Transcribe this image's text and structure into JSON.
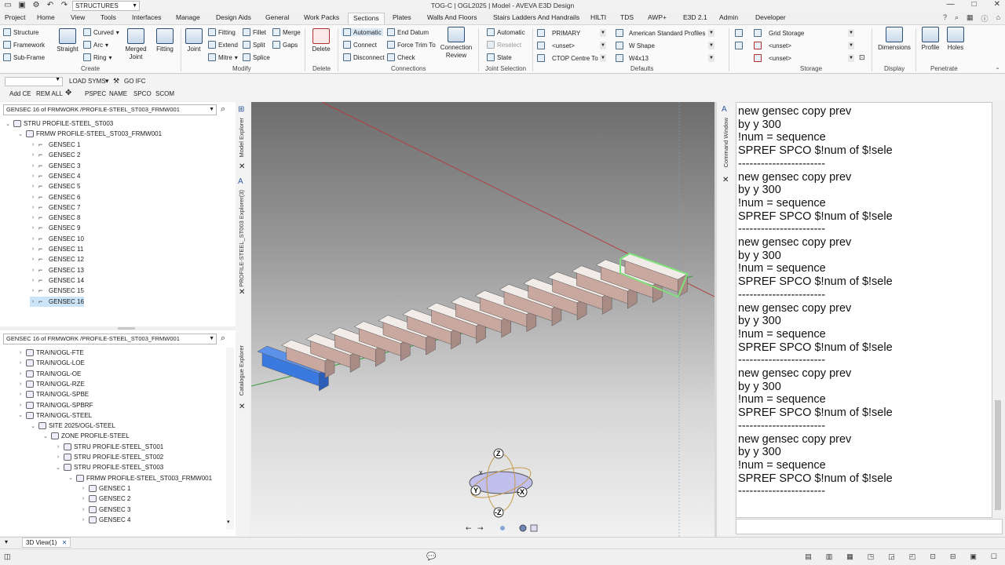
{
  "titlebar": {
    "module": "STRUCTURES",
    "title": "TOG-C | OGL2025 | Model - AVEVA E3D Design",
    "window_buttons": [
      "—",
      "□",
      "✕"
    ]
  },
  "tabs": [
    {
      "label": "Project"
    },
    {
      "label": "Home"
    },
    {
      "label": "View"
    },
    {
      "label": "Tools"
    },
    {
      "label": "Interfaces"
    },
    {
      "label": "Manage"
    },
    {
      "label": "Design Aids"
    },
    {
      "label": "General"
    },
    {
      "label": "Work Packs"
    },
    {
      "label": "Sections"
    },
    {
      "label": "Plates"
    },
    {
      "label": "Walls And Floors"
    },
    {
      "label": "Stairs Ladders And Handrails"
    },
    {
      "label": "HILTI"
    },
    {
      "label": "TDS"
    },
    {
      "label": "AWP+"
    },
    {
      "label": "E3D 2.1"
    },
    {
      "label": "Admin"
    },
    {
      "label": "Developer"
    }
  ],
  "active_tab": "Sections",
  "ribbon": {
    "create": {
      "structure": "Structure",
      "framework": "Framework",
      "subframe": "Sub-Frame",
      "straight": "Straight",
      "curved": "Curved",
      "arc": "Arc",
      "ring": "Ring",
      "merged_joint": "Merged Joint",
      "fitting": "Fitting",
      "label": "Create"
    },
    "modify": {
      "joint": "Joint",
      "fitting": "Fitting",
      "fillet": "Fillet",
      "merge": "Merge",
      "extend": "Extend",
      "split": "Split",
      "gaps": "Gaps",
      "mitre": "Mitre",
      "splice": "Splice",
      "label": "Modify"
    },
    "delete": {
      "delete": "Delete",
      "label": "Delete"
    },
    "connections": {
      "automatic": "Automatic",
      "connect": "Connect",
      "disconnect": "Disconnect",
      "end_datum": "End Datum",
      "force_trim": "Force Trim To",
      "check": "Check",
      "connection_review": "Connection Review",
      "label": "Connections"
    },
    "joint_selection": {
      "automatic": "Automatic",
      "reselect": "Reselect",
      "state": "State",
      "label": "Joint Selection"
    },
    "defaults": {
      "primary": "PRIMARY",
      "unset": "<unset>",
      "ctop": "CTOP Centre To",
      "profiles": "American Standard Profiles",
      "wshape": "W Shape",
      "w4x13": "W4x13",
      "label": "Defaults"
    },
    "storage": {
      "grid": "Grid Storage",
      "unset1": "<unset>",
      "unset2": "<unset>",
      "label": "Storage"
    },
    "display": {
      "dimensions": "Dimensions",
      "label": "Display"
    },
    "penetrate": {
      "profile": "Profile",
      "holes": "Holes",
      "label": "Penetrate"
    }
  },
  "toolbar2": {
    "load_syms": "LOAD SYMS",
    "go_ifc": "GO IFC",
    "add_ce": "Add CE",
    "rem_all": "REM ALL",
    "pspec": "PSPEC",
    "name": "NAME",
    "spco": "SPCO",
    "scom": "SCOM"
  },
  "model_explorer": {
    "tab": "Model Explorer",
    "secondary_tab": "PROFILE-STEEL_ST003 Explorer(3)",
    "header": "GENSEC 16 of FRMWORK /PROFILE-STEEL_ST003_FRMW001",
    "stru": "STRU PROFILE-STEEL_ST003",
    "frmw": "FRMW PROFILE-STEEL_ST003_FRMW001",
    "gensecs": [
      "GENSEC 1",
      "GENSEC 2",
      "GENSEC 3",
      "GENSEC 4",
      "GENSEC 5",
      "GENSEC 6",
      "GENSEC 7",
      "GENSEC 8",
      "GENSEC 9",
      "GENSEC 10",
      "GENSEC 11",
      "GENSEC 12",
      "GENSEC 13",
      "GENSEC 14",
      "GENSEC 15",
      "GENSEC 16"
    ]
  },
  "catalogue_explorer": {
    "tab": "Catalogue Explorer",
    "header": "GENSEC 16 of FRMWORK /PROFILE-STEEL_ST003_FRMW001",
    "trains": [
      "TRAIN/OGL-FTE",
      "TRAIN/OGL-LOE",
      "TRAIN/OGL-OE",
      "TRAIN/OGL-RZE",
      "TRAIN/OGL-SPBE",
      "TRAIN/OGL-SPBRF",
      "TRAIN/OGL-STEEL"
    ],
    "site": "SITE 2025/OGL-STEEL",
    "zone": "ZONE PROFILE-STEEL",
    "strus": [
      "STRU PROFILE-STEEL_ST001",
      "STRU PROFILE-STEEL_ST002",
      "STRU PROFILE-STEEL_ST003"
    ],
    "frmw": "FRMW PROFILE-STEEL_ST003_FRMW001",
    "gensecs": [
      "GENSEC 1",
      "GENSEC 2",
      "GENSEC 3",
      "GENSEC 4"
    ]
  },
  "command_window": {
    "tab": "Command Window",
    "lines": [
      "new gensec copy prev",
      "by y 300",
      "!num = sequence",
      "SPREF SPCO $!num of $!sele",
      "-----------------------",
      "new gensec copy prev",
      "by y 300",
      "!num = sequence",
      "SPREF SPCO $!num of $!sele",
      "-----------------------",
      "new gensec copy prev",
      "by y 300",
      "!num = sequence",
      "SPREF SPCO $!num of $!sele",
      "-----------------------",
      "new gensec copy prev",
      "by y 300",
      "!num = sequence",
      "SPREF SPCO $!num of $!sele",
      "-----------------------",
      "new gensec copy prev",
      "by y 300",
      "!num = sequence",
      "SPREF SPCO $!num of $!sele",
      "-----------------------",
      "new gensec copy prev",
      "by y 300",
      "!num = sequence",
      "SPREF SPCO $!num of $!sele",
      "-----------------------"
    ]
  },
  "viewport": {
    "doc_tab": "3D View(1)",
    "gizmo": {
      "z": "Z",
      "neg_z": "-Z",
      "x": "X",
      "neg_x": "-X",
      "y": "Y"
    },
    "colors": {
      "beam": "#c9a8a0",
      "selected_beam": "#3a7ae0",
      "highlight": "#7fe07a"
    }
  }
}
